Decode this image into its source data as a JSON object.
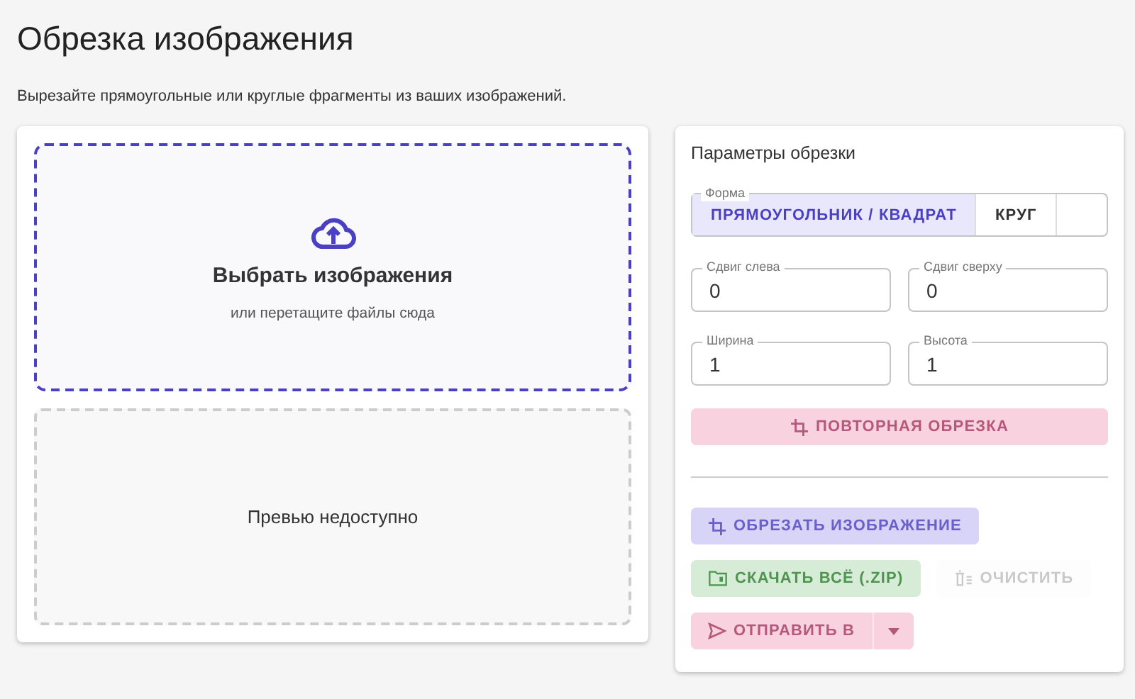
{
  "page": {
    "title": "Обрезка изображения",
    "subtitle": "Вырезайте прямоугольные или круглые фрагменты из ваших изображений."
  },
  "dropzone": {
    "title": "Выбрать изображения",
    "hint": "или перетащите файлы сюда"
  },
  "preview": {
    "text": "Превью недоступно"
  },
  "settings": {
    "title": "Параметры обрезки",
    "shape": {
      "label": "Форма",
      "options": [
        {
          "label": "ПРЯМОУГОЛЬНИК / КВАДРАТ",
          "selected": true
        },
        {
          "label": "КРУГ",
          "selected": false
        }
      ]
    },
    "fields": [
      {
        "label": "Сдвиг слева",
        "value": "0"
      },
      {
        "label": "Сдвиг сверху",
        "value": "0"
      },
      {
        "label": "Ширина",
        "value": "1"
      },
      {
        "label": "Высота",
        "value": "1"
      }
    ],
    "recrop": {
      "kind": "recrop",
      "label": "ПОВТОРНАЯ ОБРЕЗКА",
      "disabled": true
    }
  },
  "actions": [
    {
      "kind": "crop",
      "label": "ОБРЕЗАТЬ ИЗОБРАЖЕНИЕ",
      "disabled": true
    },
    {
      "kind": "zip",
      "label": "СКАЧАТЬ ВСЁ (.ZIP)",
      "disabled": true
    },
    {
      "kind": "clear",
      "label": "ОЧИСТИТЬ",
      "disabled": true
    },
    {
      "kind": "send",
      "label": "ОТПРАВИТЬ В",
      "disabled": true
    }
  ]
}
